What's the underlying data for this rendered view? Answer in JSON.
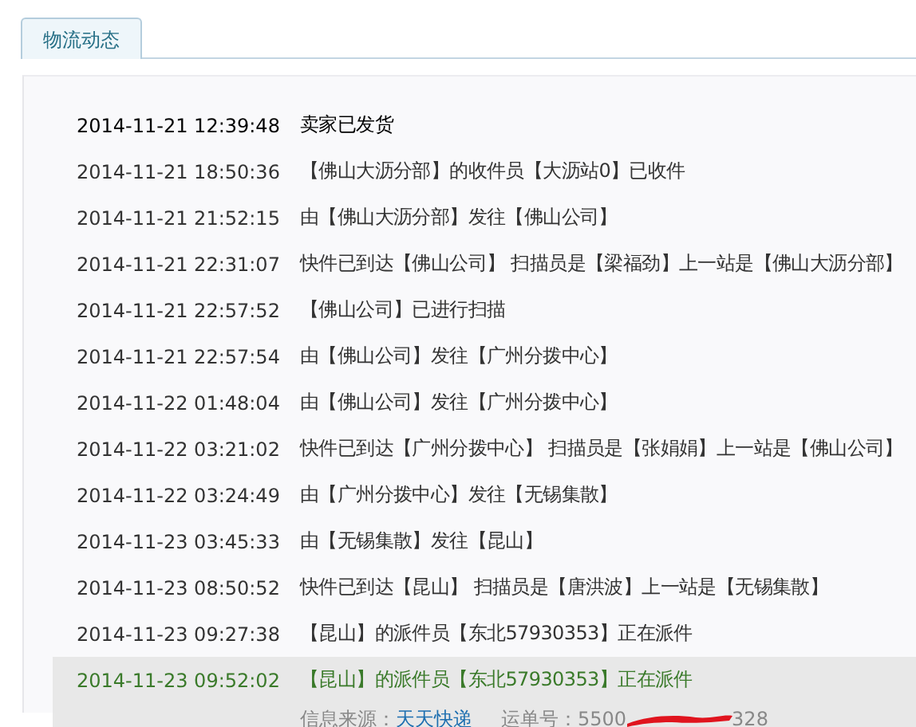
{
  "tabs": [
    {
      "label": "物流动态",
      "selected": true
    }
  ],
  "events": [
    {
      "time": "2014-11-21 12:39:48",
      "text": "卖家已发货",
      "kind": "first"
    },
    {
      "time": "2014-11-21 18:50:36",
      "text": "【佛山大沥分部】的收件员【大沥站0】已收件",
      "kind": "normal"
    },
    {
      "time": "2014-11-21 21:52:15",
      "text": "由【佛山大沥分部】发往【佛山公司】",
      "kind": "normal"
    },
    {
      "time": "2014-11-21 22:31:07",
      "text": "快件已到达【佛山公司】 扫描员是【梁福劲】上一站是【佛山大沥分部】",
      "kind": "normal"
    },
    {
      "time": "2014-11-21 22:57:52",
      "text": "【佛山公司】已进行扫描",
      "kind": "normal"
    },
    {
      "time": "2014-11-21 22:57:54",
      "text": "由【佛山公司】发往【广州分拨中心】",
      "kind": "normal"
    },
    {
      "time": "2014-11-22 01:48:04",
      "text": "由【佛山公司】发往【广州分拨中心】",
      "kind": "normal"
    },
    {
      "time": "2014-11-22 03:21:02",
      "text": "快件已到达【广州分拨中心】 扫描员是【张娟娟】上一站是【佛山公司】",
      "kind": "normal"
    },
    {
      "time": "2014-11-22 03:24:49",
      "text": "由【广州分拨中心】发往【无锡集散】",
      "kind": "normal"
    },
    {
      "time": "2014-11-23 03:45:33",
      "text": "由【无锡集散】发往【昆山】",
      "kind": "normal"
    },
    {
      "time": "2014-11-23 08:50:52",
      "text": "快件已到达【昆山】 扫描员是【唐洪波】上一站是【无锡集散】",
      "kind": "normal"
    },
    {
      "time": "2014-11-23 09:27:38",
      "text": "【昆山】的派件员【东北57930353】正在派件",
      "kind": "normal"
    },
    {
      "time": "2014-11-23 09:52:02",
      "text": "【昆山】的派件员【东北57930353】正在派件",
      "kind": "latest"
    }
  ],
  "source": {
    "label": "信息来源：",
    "carrier": "天天快递",
    "number_label": "运单号：",
    "number_start": "5500",
    "number_end": "328"
  }
}
